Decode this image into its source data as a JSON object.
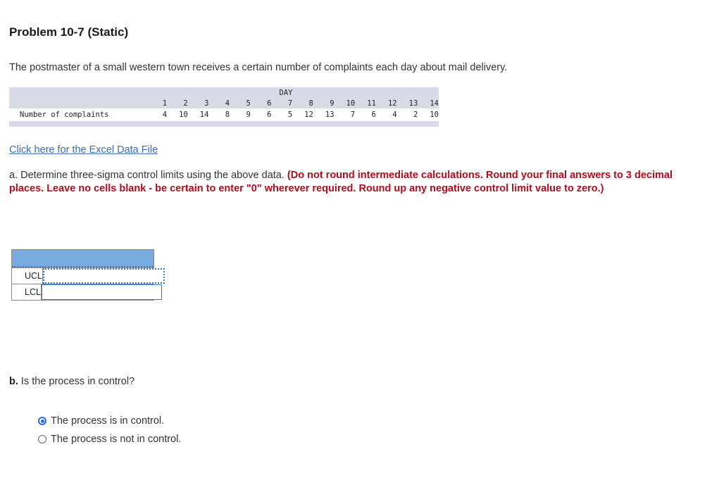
{
  "title": "Problem 10-7 (Static)",
  "intro": "The postmaster of a small western town receives a certain number of complaints each day about mail delivery.",
  "table": {
    "header_label": "DAY",
    "row_label": "Number of complaints",
    "days": [
      "1",
      "2",
      "3",
      "4",
      "5",
      "6",
      "7",
      "8",
      "9",
      "10",
      "11",
      "12",
      "13",
      "14"
    ],
    "complaints": [
      "4",
      "10",
      "14",
      "8",
      "9",
      "6",
      "5",
      "12",
      "13",
      "7",
      "6",
      "4",
      "2",
      "10"
    ]
  },
  "excel_link": "Click here for the Excel Data File",
  "part_a": {
    "text": "a. Determine three-sigma control limits using the above data. ",
    "instruction": "(Do not round intermediate calculations. Round your final answers to 3 decimal places. Leave no cells blank - be certain to enter \"0\" wherever required. Round up any negative control limit value to zero.)"
  },
  "answers": {
    "rows": [
      {
        "label": "UCL",
        "value": ""
      },
      {
        "label": "LCL",
        "value": ""
      }
    ]
  },
  "part_b": {
    "prefix": "b.",
    "question": " Is the process in control?",
    "options": [
      {
        "label": "The process is in control.",
        "selected": true
      },
      {
        "label": "The process is not in control.",
        "selected": false
      }
    ]
  }
}
